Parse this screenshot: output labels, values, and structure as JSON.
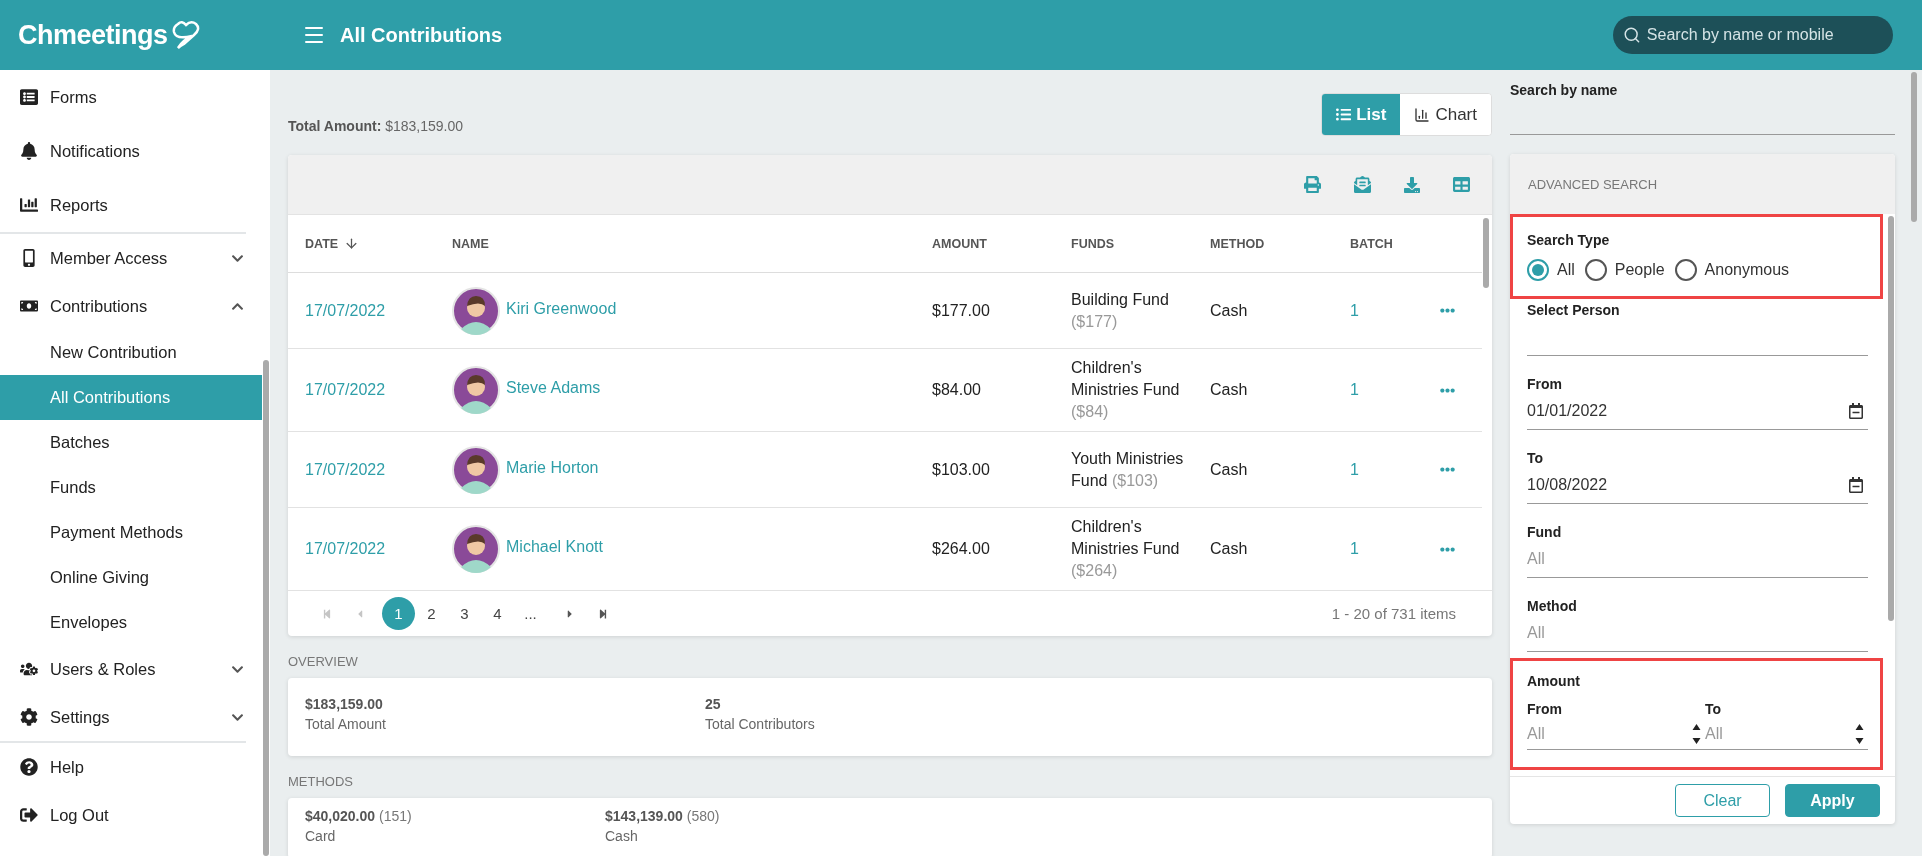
{
  "header": {
    "logo": "Chmeetings",
    "title": "All Contributions",
    "search": {
      "placeholder": "Search by name or mobile"
    }
  },
  "sidebar": {
    "sections": [
      {
        "items": [
          {
            "label": "Forms",
            "selected": false
          },
          {
            "label": "Notifications",
            "selected": false
          },
          {
            "label": "Reports",
            "selected": false
          }
        ]
      },
      {
        "items": [
          {
            "label": "Member Access",
            "selected": false,
            "expanded": false
          },
          {
            "label": "Contributions",
            "selected": false,
            "expanded": true,
            "children": [
              {
                "label": "New Contribution",
                "selected": false
              },
              {
                "label": "All Contributions",
                "selected": true
              },
              {
                "label": "Batches",
                "selected": false
              },
              {
                "label": "Funds",
                "selected": false
              },
              {
                "label": "Payment Methods",
                "selected": false
              },
              {
                "label": "Online Giving",
                "selected": false
              },
              {
                "label": "Envelopes",
                "selected": false
              }
            ]
          },
          {
            "label": "Users & Roles",
            "selected": false,
            "expanded": false
          },
          {
            "label": "Settings",
            "selected": false,
            "expanded": false
          }
        ]
      },
      {
        "items": [
          {
            "label": "Help",
            "selected": false
          },
          {
            "label": "Log Out",
            "selected": false
          }
        ]
      }
    ]
  },
  "total": {
    "label": "Total Amount:",
    "value": "$183,159.00"
  },
  "view_tabs": [
    {
      "label": "List",
      "selected": true
    },
    {
      "label": "Chart",
      "selected": false
    }
  ],
  "table": {
    "columns": [
      {
        "label": "DATE",
        "sorted": true
      },
      {
        "label": "NAME",
        "sorted": false
      },
      {
        "label": "AMOUNT",
        "sorted": false
      },
      {
        "label": "FUNDS",
        "sorted": false
      },
      {
        "label": "METHOD",
        "sorted": false
      },
      {
        "label": "BATCH",
        "sorted": false
      }
    ],
    "rows": [
      {
        "date": "17/07/2022",
        "name": "Kiri Greenwood",
        "amount": "$177.00",
        "fund": "Building Fund",
        "fund_amount": "($177)",
        "method": "Cash",
        "batch": "1"
      },
      {
        "date": "17/07/2022",
        "name": "Steve Adams",
        "amount": "$84.00",
        "fund": "Children's Ministries Fund",
        "fund_amount": "($84)",
        "method": "Cash",
        "batch": "1"
      },
      {
        "date": "17/07/2022",
        "name": "Marie Horton",
        "amount": "$103.00",
        "fund": "Youth Ministries Fund",
        "fund_amount": "($103)",
        "method": "Cash",
        "batch": "1"
      },
      {
        "date": "17/07/2022",
        "name": "Michael Knott",
        "amount": "$264.00",
        "fund": "Children's Ministries Fund",
        "fund_amount": "($264)",
        "method": "Cash",
        "batch": "1"
      }
    ],
    "pages": [
      {
        "label": "1",
        "selected": true
      },
      {
        "label": "2",
        "selected": false
      },
      {
        "label": "3",
        "selected": false
      },
      {
        "label": "4",
        "selected": false
      },
      {
        "label": "...",
        "selected": false
      }
    ],
    "pager_info": "1 - 20 of 731 items"
  },
  "overview": {
    "title": "OVERVIEW",
    "stats": [
      {
        "value": "$183,159.00",
        "label": "Total Amount"
      },
      {
        "value": "25",
        "label": "Total Contributors"
      }
    ]
  },
  "methods": {
    "title": "METHODS",
    "stats": [
      {
        "value": "$40,020.00",
        "count": "(151)",
        "label": "Card"
      },
      {
        "value": "$143,139.00",
        "count": "(580)",
        "label": "Cash"
      }
    ]
  },
  "name_search": {
    "label": "Search by name"
  },
  "advanced_search": {
    "title": "ADVANCED SEARCH",
    "search_type": {
      "label": "Search Type",
      "highlighted": true,
      "options": [
        {
          "label": "All",
          "selected": true
        },
        {
          "label": "People",
          "selected": false
        },
        {
          "label": "Anonymous",
          "selected": false
        }
      ]
    },
    "fields": [
      {
        "label": "Select Person",
        "kind": "text"
      },
      {
        "label": "From",
        "kind": "date",
        "value": "01/01/2022"
      },
      {
        "label": "To",
        "kind": "date",
        "value": "10/08/2022"
      },
      {
        "label": "Fund",
        "kind": "select",
        "placeholder": "All"
      },
      {
        "label": "Method",
        "kind": "select",
        "placeholder": "All"
      }
    ],
    "amount": {
      "label": "Amount",
      "highlighted": true,
      "from": {
        "label": "From",
        "placeholder": "All"
      },
      "to": {
        "label": "To",
        "placeholder": "All"
      }
    },
    "buttons": [
      {
        "label": "Clear",
        "kind": "outline"
      },
      {
        "label": "Apply",
        "kind": "primary"
      }
    ]
  }
}
